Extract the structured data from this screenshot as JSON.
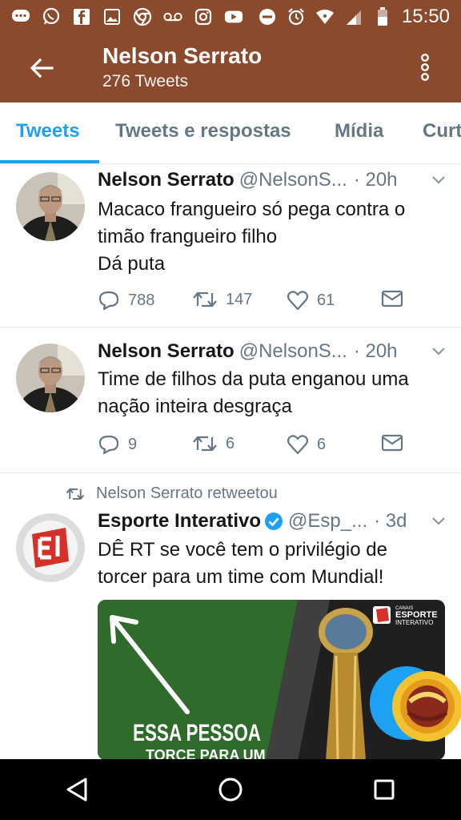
{
  "status_bar": {
    "time": "15:50"
  },
  "header": {
    "title": "Nelson Serrato",
    "subtitle": "276 Tweets"
  },
  "tabs": [
    {
      "label": "Tweets"
    },
    {
      "label": "Tweets e respostas"
    },
    {
      "label": "Mídia"
    },
    {
      "label": "Curt"
    }
  ],
  "tweets": [
    {
      "name": "Nelson Serrato",
      "handle": "@NelsonS...",
      "time": "· 20h",
      "lines": [
        "Macaco frangueiro só pega contra o",
        "timão frangueiro filho",
        "Dá puta"
      ],
      "replies": "788",
      "retweets": "147",
      "likes": "61"
    },
    {
      "name": "Nelson Serrato",
      "handle": "@NelsonS...",
      "time": "· 20h",
      "lines": [
        "Time de filhos da puta enganou uma",
        "nação inteira desgraça"
      ],
      "replies": "9",
      "retweets": "6",
      "likes": "6"
    },
    {
      "retweeted_by": "Nelson Serrato retweetou",
      "name": "Esporte Interativo",
      "handle": "@Esp_...",
      "time": "· 3d",
      "lines": [
        "DÊ RT se você tem o privilégio de",
        "torcer para um time com Mundial!"
      ],
      "media": {
        "headline": "ESSA PESSOA",
        "subline": "TORCE PARA UM",
        "channel_label": "CANAIS",
        "brand_line1": "ESPORTE",
        "brand_line2": "INTERATIVO",
        "brand_logo_letters": "EI"
      }
    }
  ],
  "colors": {
    "header": "#8a4a2b",
    "accent": "#1da1f2",
    "muted": "#657786"
  },
  "icons": [
    "back-arrow-icon",
    "more-vert-icon",
    "reply-icon",
    "retweet-icon",
    "like-icon",
    "dm-icon",
    "caret-down-icon",
    "verified-icon"
  ]
}
